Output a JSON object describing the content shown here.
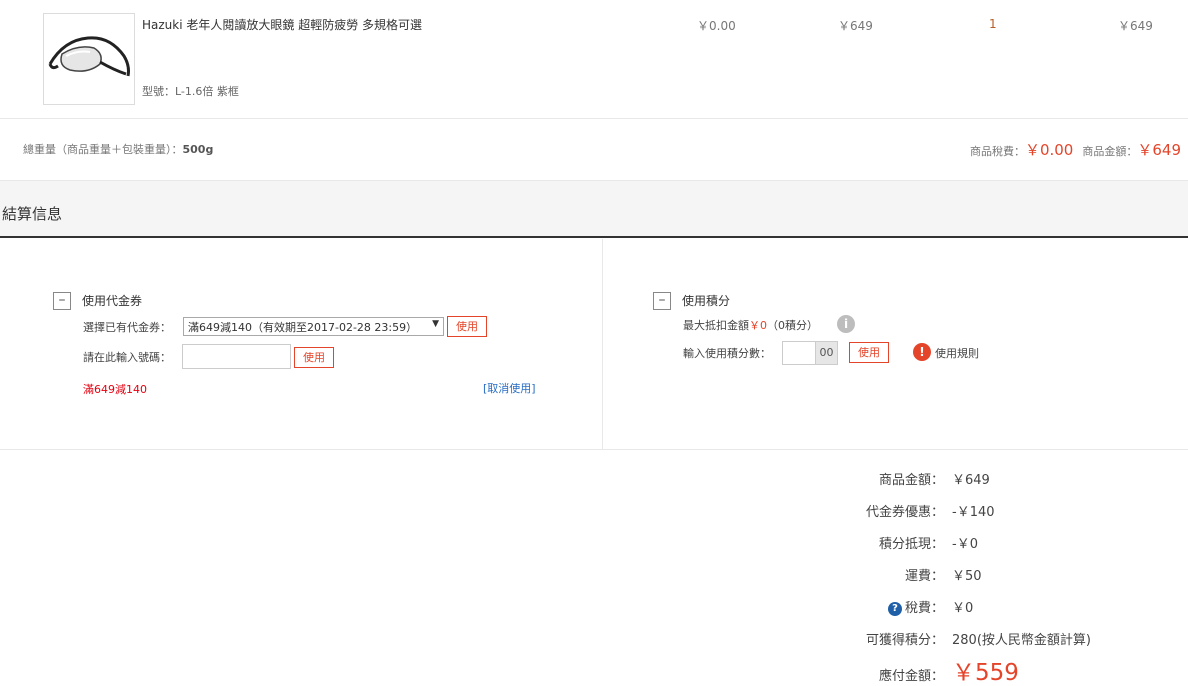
{
  "product": {
    "name": "Hazuki 老年人閱讀放大眼鏡 超輕防疲勞 多規格可選",
    "spec": "型號：L-1.6倍 紫框",
    "tax": "￥0.00",
    "price": "￥649",
    "quantity": "1",
    "subtotal": "￥649",
    "image_icon": "magnifier-glasses-icon"
  },
  "weight_row": {
    "label": "總重量（商品重量＋包裝重量）：",
    "value": "500g",
    "tax_label": "商品稅費：",
    "tax_value": "￥0.00",
    "amount_label": "商品金額：",
    "amount_value": "￥649"
  },
  "section": {
    "title": "結算信息"
  },
  "coupon": {
    "toggle": "–",
    "title": "使用代金券",
    "select_label": "選擇已有代金券：",
    "select_value": "滿649減140（有效期至2017-02-28 23:59）",
    "select_arrow": "▼",
    "use_label": "使用",
    "code_label": "請在此輸入號碼：",
    "code_value": "",
    "code_use_label": "使用",
    "applied": "滿649減140",
    "cancel": "[取消使用]"
  },
  "points": {
    "toggle": "–",
    "title": "使用積分",
    "max_label": "最大抵扣金額",
    "max_value": "￥0",
    "max_points": "（0積分）",
    "info_icon": "i",
    "input_label": "輸入使用積分數：",
    "input_value": "",
    "input_suffix": "00",
    "use_label": "使用",
    "alert_icon": "!",
    "rules": "使用規則"
  },
  "summary": {
    "items": [
      {
        "label": "商品金額：",
        "value": "￥649"
      },
      {
        "label": "代金券優惠：",
        "value": "-￥140"
      },
      {
        "label": "積分抵現：",
        "value": "-￥0"
      },
      {
        "label": "運費：",
        "value": "￥50"
      },
      {
        "label": "稅費：",
        "value": "￥0"
      },
      {
        "label": "可獲得積分：",
        "value": "280(按人民幣金額計算)"
      }
    ],
    "help_icon": "?",
    "pay_label": "應付金額：",
    "pay_value": "￥559"
  },
  "colors": {
    "accent": "#e4452a",
    "link": "#2a6ec3",
    "help": "#1f5fa8"
  }
}
